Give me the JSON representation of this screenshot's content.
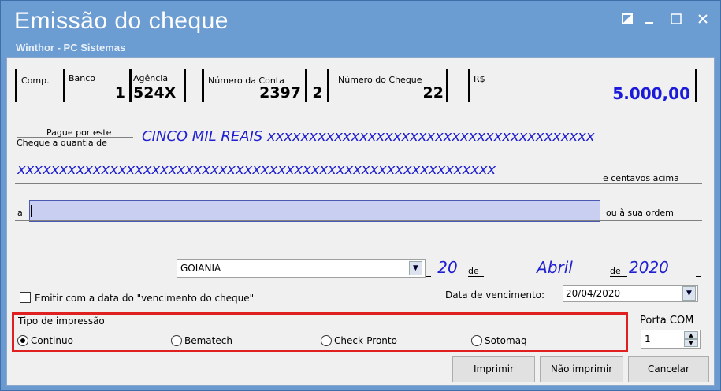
{
  "window": {
    "title": "Emissão do cheque",
    "subtitle": "Winthor - PC Sistemas",
    "controls": [
      "restore-icon",
      "minimize-icon",
      "maximize-icon",
      "close-icon"
    ]
  },
  "cheque": {
    "comp_label": "Comp.",
    "banco_label": "Banco",
    "banco_value": "1",
    "agencia_label": "Agência",
    "agencia_value": "524X",
    "conta_label": "Número da Conta",
    "conta_value": "2397",
    "conta_dv": "2",
    "cheque_label": "Número do Cheque",
    "cheque_value": "22",
    "valor_label": "R$",
    "valor_value": "5.000,00",
    "pague_label_1": "Pague por este",
    "pague_label_2": "Cheque a quantia de",
    "extenso_1": "CINCO MIL REAIS xxxxxxxxxxxxxxxxxxxxxxxxxxxxxxxxxxxxxxx",
    "extenso_2": "xxxxxxxxxxxxxxxxxxxxxxxxxxxxxxxxxxxxxxxxxxxxxxxxxxxxxxxxx",
    "centavos_label": "e centavos acima",
    "a_label": "a",
    "beneficiario_value": "",
    "ordem_label": "ou à sua ordem",
    "cidade_value": "GOIANIA",
    "dia_value": "20",
    "de1_label": "de",
    "mes_value": "Abril",
    "de2_label": "de",
    "ano_value": "2020"
  },
  "options": {
    "emitir_vencimento_label": "Emitir com a data do \"vencimento do cheque\"",
    "emitir_vencimento_checked": false,
    "data_vencimento_label": "Data de vencimento:",
    "data_vencimento_value": "20/04/2020"
  },
  "tipo_impressao": {
    "label": "Tipo de impressão",
    "options": [
      {
        "label": "Continuo",
        "selected": true
      },
      {
        "label": "Bematech",
        "selected": false
      },
      {
        "label": "Check-Pronto",
        "selected": false
      },
      {
        "label": "Sotomaq",
        "selected": false
      }
    ],
    "highlight_color": "#e02020"
  },
  "porta_com": {
    "label": "Porta COM",
    "value": "1"
  },
  "buttons": {
    "imprimir": "Imprimir",
    "nao_imprimir": "Não imprimir",
    "cancelar": "Cancelar"
  },
  "colors": {
    "titlebar": "#6c9dd2",
    "valor_text": "#1a1ad8",
    "extenso_text": "#2020d0",
    "beneficiario_bg": "#c8cff0"
  }
}
